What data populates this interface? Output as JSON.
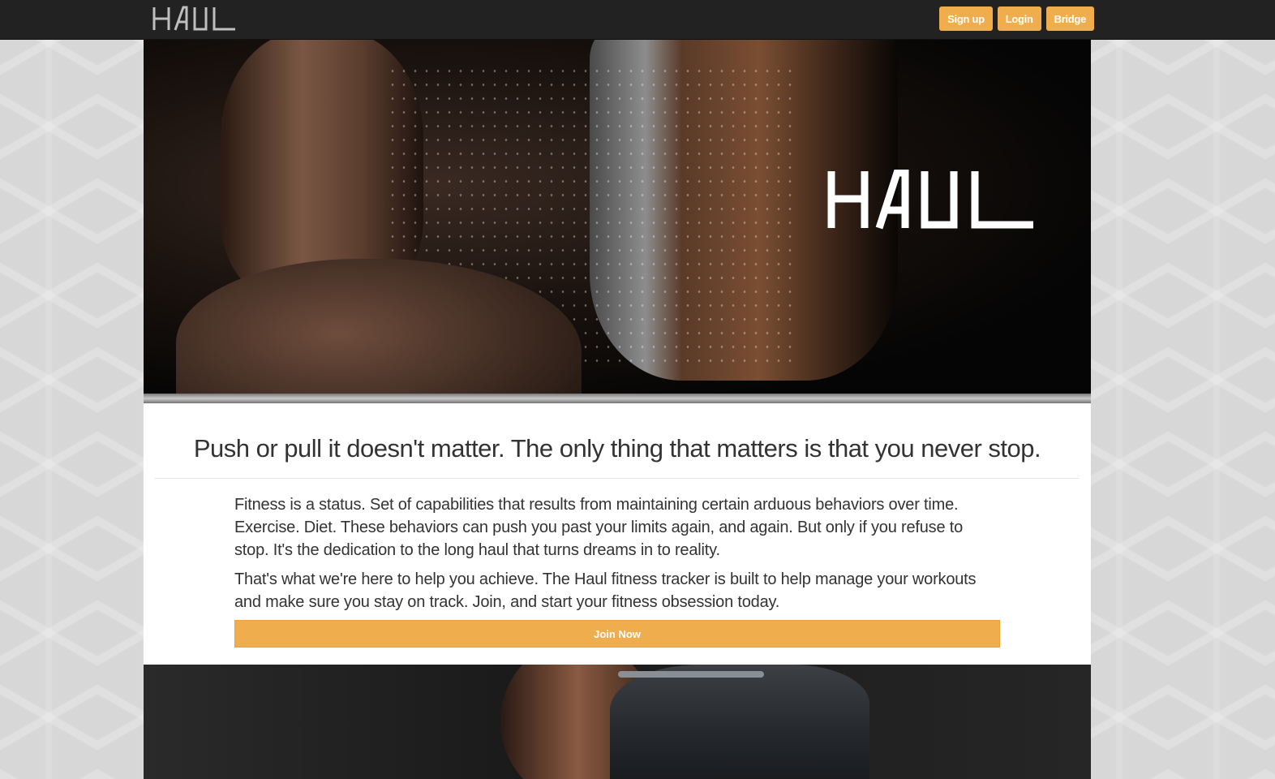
{
  "nav": {
    "brand": "HAUL",
    "buttons": [
      {
        "label": "Sign up"
      },
      {
        "label": "Login"
      },
      {
        "label": "Bridge"
      }
    ]
  },
  "hero": {
    "logo_text": "HAUL"
  },
  "intro": {
    "headline": "Push or pull it doesn't matter. The only thing that matters is that you never stop.",
    "paragraphs": [
      "Fitness is a status. Set of capabilities that results from maintaining certain arduous behaviors over time. Exercise. Diet. These behaviors can push you past your limits again, and again. But only if you refuse to stop. It's the dedication to the long haul that turns dreams in to reality.",
      "That's what we're here to help you achieve. The Haul fitness tracker is built to help manage your workouts and make sure you stay on track. Join, and start your fitness obsession today."
    ],
    "cta_label": "Join Now"
  },
  "colors": {
    "navbar": "#222222",
    "accent": "#f0ad4e",
    "page_bg": "#d7d7d7"
  }
}
